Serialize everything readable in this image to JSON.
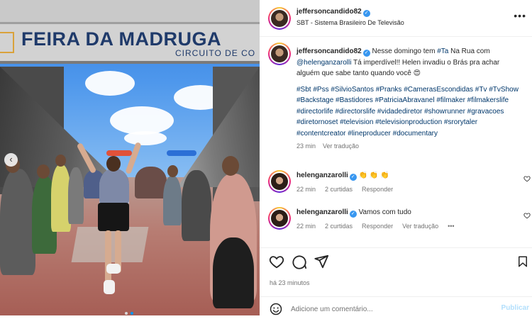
{
  "post": {
    "photo_sign_title": "FEIRA DA MADRUGA",
    "photo_sign_subtitle": "CIRCUITO DE CO",
    "carousel_prev": "‹"
  },
  "header": {
    "username": "jeffersoncandido82",
    "verified": "✓",
    "subtitle": "SBT - Sistema Brasileiro De Televisão",
    "more": "•••"
  },
  "caption": {
    "username": "jeffersoncandido82",
    "verified": "✓",
    "text_1": " Nesse domingo tem ",
    "tag_tanarua": "#Ta",
    "text_2": " Na Rua com ",
    "mention": "@helenganzarolli",
    "text_3": " Tá imperdível!! Helen invadiu o Brás pra achar alguém que sabe tanto quando você 😍",
    "hashtags": "#Sbt #Pss #SilvioSantos #Pranks #CamerasEscondidas #Tv #TvShow #Backstage #Bastidores #PatriciaAbravanel #filmaker #filmakerslife #directorlife #directorslife #vidadediretor #showrunner #gravacoes #diretornoset #television #televisionproduction #srorytaler #contentcreator #lineproducer #documentary",
    "time": "23 min",
    "translate": "Ver tradução"
  },
  "comments": [
    {
      "username": "helenganzarolli",
      "verified": "✓",
      "text": " 👏 👏 👏",
      "time": "22 min",
      "likes": "2 curtidas",
      "reply": "Responder"
    },
    {
      "username": "helenganzarolli",
      "verified": "✓",
      "text": " Vamos com tudo",
      "time": "22 min",
      "likes": "2 curtidas",
      "reply": "Responder",
      "translate": "Ver tradução",
      "more": "•••"
    }
  ],
  "footer": {
    "posted_ago": "há 23 minutos",
    "comment_placeholder": "Adicione um comentário...",
    "post_button": "Publicar"
  },
  "colors": {
    "link": "#00376b",
    "verified": "#3897f0",
    "muted": "#737373",
    "post_button_disabled": "#b2dffc"
  }
}
